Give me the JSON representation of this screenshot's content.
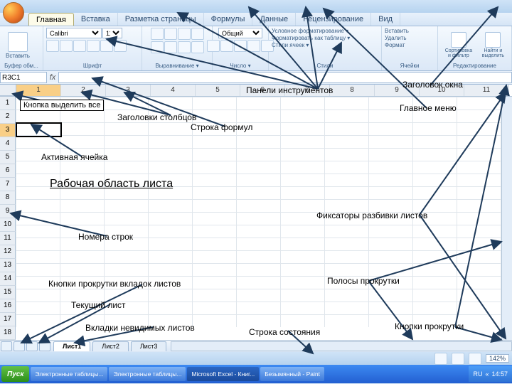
{
  "office_button": "Office",
  "menu": {
    "tabs": [
      "Главная",
      "Вставка",
      "Разметка страницы",
      "Формулы",
      "Данные",
      "Рецензирование",
      "Вид"
    ],
    "active": 0
  },
  "ribbon": {
    "groups": [
      {
        "label": "Буфер обм...",
        "paste": "Вставить"
      },
      {
        "label": "Шрифт",
        "font": "Calibri",
        "size": "11"
      },
      {
        "label": "Выравнивание ▾"
      },
      {
        "label": "Число ▾",
        "format": "Общий"
      },
      {
        "label": "Стили",
        "cond": "Условное форм­атирование ▾",
        "fmttbl": "Форматировать как таблицу ▾",
        "cellstyle": "Стили ячеек ▾"
      },
      {
        "label": "Ячейки",
        "ins": "Вставить",
        "del": "Удалить",
        "fmt": "Формат"
      },
      {
        "label": "Редактирование",
        "sort": "Сортировка и фильтр",
        "find": "Найти и выделить"
      }
    ]
  },
  "namebox": {
    "ref": "R3C1",
    "fx": "fx"
  },
  "columns": [
    "1",
    "2",
    "3",
    "4",
    "5",
    "6",
    "7",
    "8",
    "9",
    "10",
    "11"
  ],
  "active_column_index": 0,
  "rows": [
    "1",
    "2",
    "3",
    "4",
    "5",
    "6",
    "7",
    "8",
    "9",
    "10",
    "11",
    "12",
    "13",
    "14",
    "15",
    "16",
    "17",
    "18"
  ],
  "active_row_index": 2,
  "active_cell": "R3C1",
  "sheets": {
    "nav": [
      "|◀",
      "◀",
      "▶",
      "▶|"
    ],
    "tabs": [
      "Лист1",
      "Лист2",
      "Лист3"
    ],
    "active": 0
  },
  "status": {
    "zoom": "142%"
  },
  "taskbar": {
    "start": "Пуск",
    "items": [
      "Электронные таблицы...",
      "Электронные таблицы...",
      "Microsoft Excel - Книг...",
      "Безымянный - Paint"
    ],
    "active_index": 2,
    "time": "14:57"
  },
  "annotations": {
    "select_all": "Кнопка выделить все",
    "col_headers": "Заголовки столбцов",
    "toolbars": "Панели инструментов",
    "title": "Заголовок окна",
    "mainmenu": "Главное меню",
    "formula_bar": "Строка формул",
    "active_cell": "Активная ячейка",
    "work_area": "Рабочая область листа",
    "split_fixators": "Фиксаторы разбивки листов",
    "row_numbers": "Номера строк",
    "sheet_nav": "Кнопки прокрутки вкладок листов",
    "current_sheet": "Текущий лист",
    "hidden_tabs": "Вкладки невидимых листов",
    "status_row": "Строка состояния",
    "scrollbars": "Полосы прокрутки",
    "scroll_buttons": "Кнопки прокрутки"
  }
}
